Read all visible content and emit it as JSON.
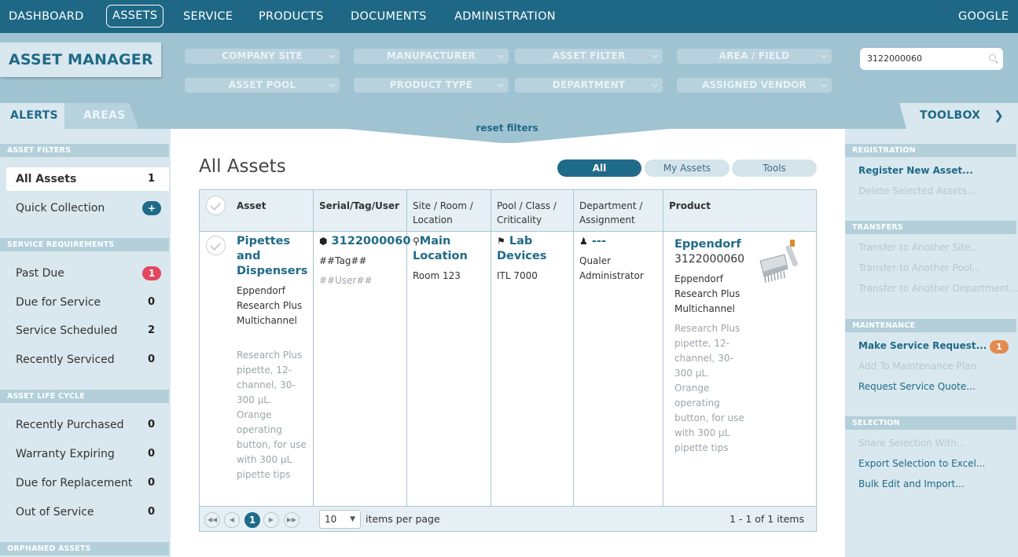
{
  "topnav": {
    "items": [
      "DASHBOARD",
      "ASSETS",
      "SERVICE",
      "PRODUCTS",
      "DOCUMENTS",
      "ADMINISTRATION"
    ],
    "active": "ASSETS",
    "right": "GOOGLE"
  },
  "header": {
    "title": "ASSET MANAGER",
    "filters": [
      "COMPANY SITE",
      "MANUFACTURER",
      "ASSET FILTER",
      "AREA / FIELD",
      "ASSET POOL",
      "PRODUCT TYPE",
      "DEPARTMENT",
      "ASSIGNED VENDOR"
    ],
    "search_value": "3122000060",
    "reset_filters": "reset filters"
  },
  "tabs": {
    "alerts": "ALERTS",
    "areas": "AREAS",
    "toolbox": "TOOLBOX"
  },
  "left": {
    "asset_filters": {
      "title": "ASSET FILTERS",
      "items": [
        {
          "label": "All Assets",
          "count": "1"
        },
        {
          "label": "Quick Collection",
          "badge": "+"
        }
      ]
    },
    "service": {
      "title": "SERVICE REQUIREMENTS",
      "items": [
        {
          "label": "Past Due",
          "count": "1"
        },
        {
          "label": "Due for Service",
          "count": "0"
        },
        {
          "label": "Service Scheduled",
          "count": "2"
        },
        {
          "label": "Recently Serviced",
          "count": "0"
        }
      ]
    },
    "lifecycle": {
      "title": "ASSET LIFE CYCLE",
      "items": [
        {
          "label": "Recently Purchased",
          "count": "0"
        },
        {
          "label": "Warranty Expiring",
          "count": "0"
        },
        {
          "label": "Due for Replacement",
          "count": "0"
        },
        {
          "label": "Out of Service",
          "count": "0"
        }
      ]
    },
    "orphaned": {
      "title": "ORPHANED ASSETS"
    }
  },
  "right": {
    "registration": {
      "title": "REGISTRATION",
      "items": [
        "Register New Asset...",
        "Delete Selected Assets..."
      ]
    },
    "transfers": {
      "title": "TRANSFERS",
      "items": [
        "Transfer to Another Site...",
        "Transfer to Another Pool...",
        "Transfer to Another Department..."
      ]
    },
    "maintenance": {
      "title": "MAINTENANCE",
      "items": [
        "Make Service Request...",
        "Add To Maintenance Plan",
        "Request Service Quote..."
      ],
      "badge": "1"
    },
    "selection": {
      "title": "SELECTION",
      "items": [
        "Share Selection With...",
        "Export Selection to Excel...",
        "Bulk Edit and Import..."
      ]
    }
  },
  "main": {
    "title": "All Assets",
    "segments": [
      "All",
      "My Assets",
      "Tools"
    ],
    "columns": [
      "Asset",
      "Serial/Tag/User",
      "Site / Room / Location",
      "Pool / Class / Criticality",
      "Department / Assignment",
      "Product"
    ],
    "row": {
      "asset_name": "Pipettes and Dispensers",
      "asset_model": "Eppendorf Research Plus Multichannel",
      "asset_desc": "Research Plus pipette, 12-channel, 30-300 µL. Orange operating button, for use with 300 µL pipette tips",
      "serial": "3122000060",
      "tag": "##Tag##",
      "user": "##User##",
      "site": "Main Location",
      "room": "Room 123",
      "pool": "Lab Devices",
      "class": "ITL 7000",
      "department": "---",
      "assignment": "Qualer Administrator",
      "product_brand": "Eppendorf",
      "product_serial": "3122000060",
      "product_name": "Eppendorf Research Plus Multichannel",
      "product_desc": "Research Plus pipette, 12-channel, 30-300 µL. Orange operating button, for use with 300 µL pipette tips"
    },
    "pager": {
      "current": "1",
      "per_page": "10",
      "per_page_label": "items per page",
      "summary": "1 - 1 of 1 items"
    }
  }
}
